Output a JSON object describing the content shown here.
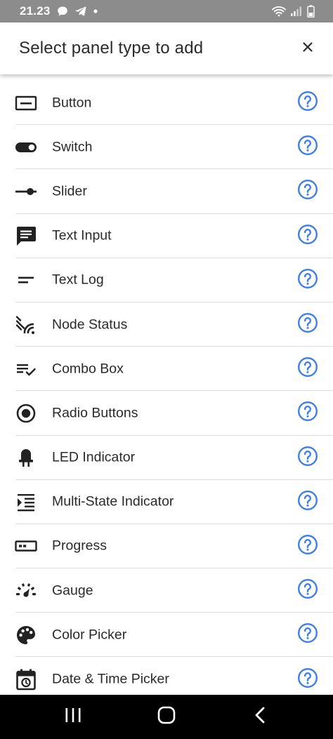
{
  "status_bar": {
    "time": "21.23",
    "icons": [
      "chat-bubble-icon",
      "telegram-icon",
      "dot-icon",
      "wifi-icon",
      "signal-icon",
      "battery-icon"
    ]
  },
  "dialog": {
    "title": "Select panel type to add",
    "close_icon": "close-icon"
  },
  "colors": {
    "accent": "#3d7ee8",
    "icon": "#222222",
    "text": "#2a2a2a",
    "divider": "#dcdcdc",
    "status_bar": "#8c8c8c",
    "nav_bar": "#000000"
  },
  "panel_types": [
    {
      "label": "Button",
      "icon": "button-icon"
    },
    {
      "label": "Switch",
      "icon": "toggle-switch-icon"
    },
    {
      "label": "Slider",
      "icon": "slider-icon"
    },
    {
      "label": "Text Input",
      "icon": "message-icon"
    },
    {
      "label": "Text Log",
      "icon": "short-text-icon"
    },
    {
      "label": "Node Status",
      "icon": "signal-status-icon"
    },
    {
      "label": "Combo Box",
      "icon": "list-check-icon"
    },
    {
      "label": "Radio Buttons",
      "icon": "radio-button-icon"
    },
    {
      "label": "LED Indicator",
      "icon": "led-icon"
    },
    {
      "label": "Multi-State Indicator",
      "icon": "indent-list-icon"
    },
    {
      "label": "Progress",
      "icon": "progress-icon"
    },
    {
      "label": "Gauge",
      "icon": "gauge-icon"
    },
    {
      "label": "Color Picker",
      "icon": "palette-icon"
    },
    {
      "label": "Date & Time Picker",
      "icon": "calendar-icon"
    }
  ],
  "help_icon": "help-circle-icon",
  "nav_bar": {
    "buttons": [
      "recents-icon",
      "home-icon",
      "back-icon"
    ]
  }
}
